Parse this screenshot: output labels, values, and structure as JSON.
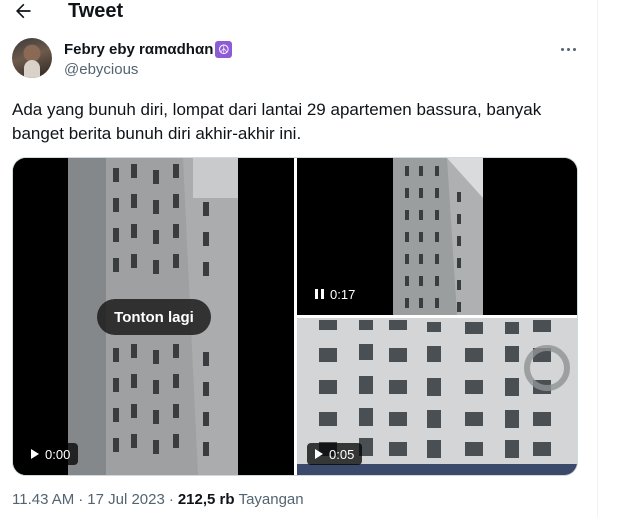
{
  "header": {
    "title": "Tweet"
  },
  "author": {
    "display_name": "Febry eby rαmαdhαn",
    "emoji": "☮",
    "handle": "@ebycious"
  },
  "tweet": {
    "text": "Ada yang bunuh diri, lompat dari lantai 29 apartemen bassura, banyak banget berita bunuh diri akhir-akhir ini."
  },
  "media": [
    {
      "duration": "0:00",
      "state": "ended",
      "replay_label": "Tonton lagi"
    },
    {
      "duration": "0:17",
      "state": "paused"
    },
    {
      "duration": "0:05",
      "state": "playing"
    }
  ],
  "meta": {
    "time": "11.43 AM",
    "sep1": "·",
    "date": "17 Jul 2023",
    "sep2": "·",
    "views_count": "212,5 rb",
    "views_label": "Tayangan"
  },
  "colors": {
    "text": "#0f1419",
    "secondary": "#536471",
    "border": "#cfd9de",
    "peace_badge": "#8e5bd6"
  }
}
